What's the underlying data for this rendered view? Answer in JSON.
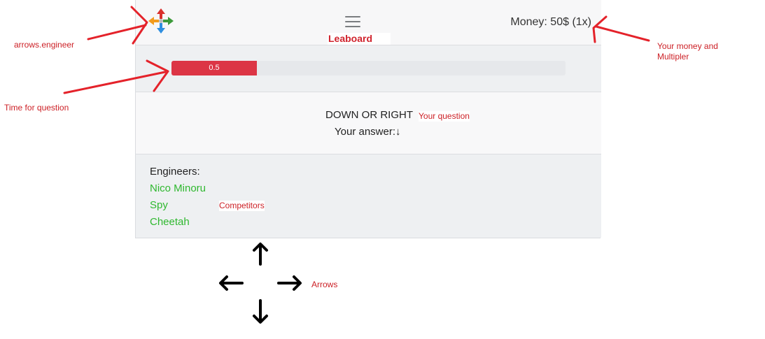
{
  "header": {
    "leaderboard_label": "Leaboard",
    "money_text": "Money: 50$ (1x)"
  },
  "timer": {
    "progress": 0.5,
    "progress_label": "0.5",
    "progress_color": "#dc3545"
  },
  "question": {
    "text": "DOWN OR RIGHT",
    "answer_label": "Your answer:",
    "answer_value": "↓"
  },
  "competitors": {
    "title": "Engineers:",
    "names": [
      "Nico Minoru",
      "Spy",
      "Cheetah"
    ],
    "name_color": "#2fb82f"
  },
  "controls": {
    "icons": [
      "arrow-up-icon",
      "arrow-left-icon",
      "arrow-right-icon",
      "arrow-down-icon"
    ]
  },
  "annotations": {
    "logo": "arrows.engineer",
    "timer": "Time for question",
    "question": "Your question",
    "competitors": "Competitors",
    "money_line1": "Your money and",
    "money_line2": "Multipler",
    "arrows": "Arrows",
    "color": "#cc1f25"
  }
}
